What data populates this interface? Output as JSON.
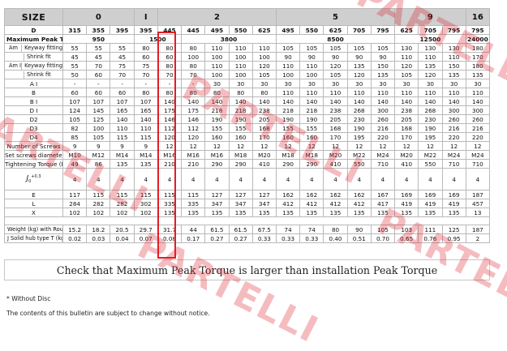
{
  "header": {
    "size_label": "SIZE",
    "groups": [
      "0",
      "I",
      "2",
      "5",
      "9",
      "16"
    ],
    "d_label": "D",
    "d_values": [
      "315",
      "355",
      "395",
      "395",
      "445",
      "445",
      "495",
      "550",
      "625",
      "495",
      "550",
      "625",
      "705",
      "795",
      "625",
      "705",
      "795",
      "795"
    ]
  },
  "max_peak_torque": {
    "label": "Maximum Peak Torque (Nm)",
    "values": [
      "950",
      "1500",
      "3800",
      "8500",
      "12500",
      "24000"
    ]
  },
  "row_groups": {
    "am": "Am",
    "am1": "Am I"
  },
  "rows": [
    {
      "name": "Keyway fitting",
      "values": [
        "55",
        "55",
        "55",
        "80",
        "80",
        "80",
        "110",
        "110",
        "110",
        "105",
        "105",
        "105",
        "105",
        "105",
        "130",
        "130",
        "130",
        "180"
      ]
    },
    {
      "name": "Shrink fit",
      "values": [
        "45",
        "45",
        "45",
        "60",
        "60",
        "100",
        "100",
        "100",
        "100",
        "90",
        "90",
        "90",
        "90",
        "90",
        "110",
        "110",
        "110",
        "170"
      ]
    },
    {
      "name": "Keyway fitting",
      "values": [
        "55",
        "70",
        "75",
        "75",
        "80",
        "80",
        "110",
        "110",
        "120",
        "110",
        "110",
        "120",
        "135",
        "150",
        "120",
        "135",
        "150",
        "180"
      ]
    },
    {
      "name": "Shrink fit",
      "values": [
        "50",
        "60",
        "70",
        "70",
        "70",
        "70",
        "100",
        "100",
        "105",
        "100",
        "100",
        "105",
        "120",
        "135",
        "105",
        "120",
        "135",
        "135"
      ]
    },
    {
      "name": "A I",
      "values": [
        "-",
        "-",
        "-",
        "-",
        "-",
        "-",
        "30",
        "30",
        "30",
        "30",
        "30",
        "30",
        "30",
        "30",
        "30",
        "30",
        "30",
        "30"
      ]
    },
    {
      "name": "B",
      "values": [
        "60",
        "60",
        "60",
        "80",
        "80",
        "80",
        "80",
        "80",
        "80",
        "110",
        "110",
        "110",
        "110",
        "110",
        "110",
        "110",
        "110",
        "110"
      ]
    },
    {
      "name": "B I",
      "values": [
        "107",
        "107",
        "107",
        "107",
        "140",
        "140",
        "140",
        "140",
        "140",
        "140",
        "140",
        "140",
        "140",
        "140",
        "140",
        "140",
        "140",
        "140"
      ]
    },
    {
      "name": "D I",
      "values": [
        "124",
        "145",
        "165",
        "165",
        "175",
        "175",
        "218",
        "218",
        "238",
        "218",
        "218",
        "238",
        "268",
        "300",
        "238",
        "268",
        "300",
        "300"
      ]
    },
    {
      "name": "D2",
      "values": [
        "105",
        "125",
        "140",
        "140",
        "146",
        "146",
        "190",
        "190",
        "205",
        "190",
        "190",
        "205",
        "230",
        "260",
        "205",
        "230",
        "260",
        "260"
      ]
    },
    {
      "name": "D3",
      "values": [
        "82",
        "100",
        "110",
        "110",
        "112",
        "112",
        "155",
        "155",
        "168",
        "155",
        "155",
        "168",
        "190",
        "216",
        "168",
        "190",
        "216",
        "216"
      ]
    },
    {
      "name": "D4",
      "values": [
        "85",
        "105",
        "115",
        "115",
        "120",
        "120",
        "160",
        "160",
        "170",
        "160",
        "160",
        "170",
        "195",
        "220",
        "170",
        "195",
        "220",
        "220"
      ]
    },
    {
      "name": "Number of Screws",
      "values": [
        "9",
        "9",
        "9",
        "9",
        "12",
        "12",
        "12",
        "12",
        "12",
        "12",
        "12",
        "12",
        "12",
        "12",
        "12",
        "12",
        "12",
        "12"
      ]
    },
    {
      "name": "Set screws diameter",
      "values": [
        "M10",
        "M12",
        "M14",
        "M14",
        "M16",
        "M16",
        "M16",
        "M18",
        "M20",
        "M18",
        "M18",
        "M20",
        "M22",
        "M24",
        "M20",
        "M22",
        "M24",
        "M24"
      ]
    },
    {
      "name": "Tightening Torque (Nm)",
      "values": [
        "49",
        "86",
        "135",
        "135",
        "210",
        "210",
        "290",
        "290",
        "410",
        "290",
        "290",
        "410",
        "550",
        "710",
        "410",
        "550",
        "710",
        "710"
      ]
    },
    {
      "name": "J0 +0.3",
      "values": [
        "4",
        "4",
        "4",
        "4",
        "4",
        "4",
        "4",
        "4",
        "4",
        "4",
        "4",
        "4",
        "4",
        "4",
        "4",
        "4",
        "4",
        "4"
      ]
    },
    {
      "name": "E",
      "values": [
        "117",
        "115",
        "115",
        "115",
        "115",
        "115",
        "127",
        "127",
        "127",
        "162",
        "162",
        "162",
        "162",
        "167",
        "169",
        "169",
        "169",
        "187"
      ]
    },
    {
      "name": "L",
      "values": [
        "284",
        "282",
        "282",
        "302",
        "335",
        "335",
        "347",
        "347",
        "347",
        "412",
        "412",
        "412",
        "412",
        "417",
        "419",
        "419",
        "419",
        "457"
      ]
    },
    {
      "name": "X",
      "values": [
        "102",
        "102",
        "102",
        "102",
        "135",
        "135",
        "135",
        "135",
        "135",
        "135",
        "135",
        "135",
        "135",
        "135",
        "135",
        "135",
        "135",
        "13"
      ]
    }
  ],
  "weight_rows": [
    {
      "name": "Weight (kg) with Rough bore*",
      "values": [
        "15.2",
        "18.2",
        "20.5",
        "29.7",
        "31.7",
        "44",
        "61.5",
        "61.5",
        "67.5",
        "74",
        "74",
        "80",
        "90",
        "105",
        "103",
        "111",
        "125",
        "187"
      ]
    },
    {
      "name": "J Solid hub type T (kgm²)*",
      "values": [
        "0.02",
        "0.03",
        "0.04",
        "0.07",
        "0.08",
        "0.17",
        "0.27",
        "0.27",
        "0.33",
        "0.33",
        "0.33",
        "0.40",
        "0.51",
        "0.70",
        "0.65",
        "0.76",
        "0.95",
        "2"
      ]
    }
  ],
  "j_symbol": "J",
  "j_sub": "0",
  "j_sup": "+0.3",
  "notice": "Check that Maximum Peak Torque is larger than installation Peak Torque",
  "footnote_1": "* Without Disc",
  "footnote_2": "The contents of this bulletin are subject to change without notice.",
  "watermark": "PARTELLI",
  "colors": {
    "highlight": "#e31d23",
    "header_bg": "#cfcfcf",
    "watermark": "#de222e"
  }
}
